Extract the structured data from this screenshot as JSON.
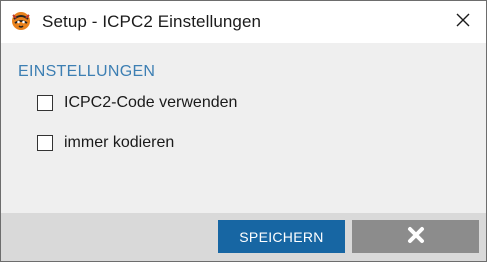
{
  "window": {
    "title": "Setup - ICPC2 Einstellungen",
    "app_icon": "tiger-logo-icon",
    "close_icon": "close-icon"
  },
  "settings": {
    "heading": "EINSTELLUNGEN",
    "options": [
      {
        "label": "ICPC2-Code verwenden",
        "checked": false
      },
      {
        "label": "immer kodieren",
        "checked": false
      }
    ]
  },
  "footer": {
    "save_label": "SPEICHERN",
    "cancel_icon": "x-icon"
  },
  "colors": {
    "accent": "#3d7fb3",
    "save_button": "#1766a3",
    "cancel_button": "#8c8c8c",
    "content_bg": "#efefef",
    "footer_bg": "#d9d9d9"
  }
}
